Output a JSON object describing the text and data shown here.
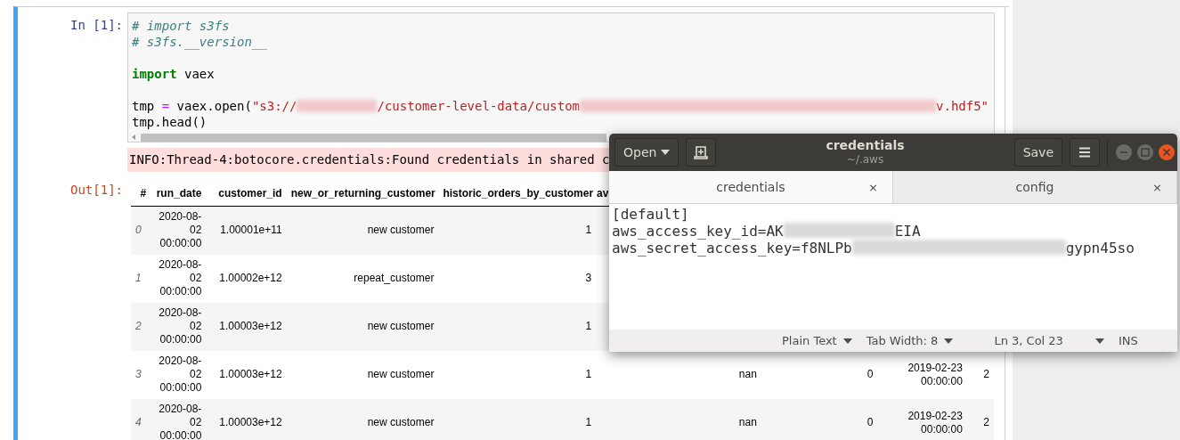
{
  "notebook": {
    "in_prompt": "In [1]:",
    "code_lines": [
      {
        "kind": "code",
        "tokens": [
          {
            "kind": "comment",
            "text": "# import s3fs"
          }
        ]
      },
      {
        "kind": "code",
        "tokens": [
          {
            "kind": "comment",
            "text": "# s3fs.__version__"
          }
        ]
      },
      {
        "kind": "blank"
      },
      {
        "kind": "code",
        "tokens": [
          {
            "kind": "keyword",
            "text": "import"
          },
          {
            "kind": "plain",
            "text": " vaex"
          }
        ]
      },
      {
        "kind": "blank"
      },
      {
        "kind": "code",
        "tokens": [
          {
            "kind": "plain",
            "text": "tmp "
          },
          {
            "kind": "operator",
            "text": "="
          },
          {
            "kind": "plain",
            "text": " vaex.open("
          },
          {
            "kind": "string",
            "text": "\"s3://"
          },
          {
            "kind": "redaction"
          },
          {
            "kind": "string",
            "text": "/customer-level-data/custom"
          },
          {
            "kind": "redaction"
          },
          {
            "kind": "string",
            "text": "v.hdf5\""
          }
        ]
      },
      {
        "kind": "code",
        "tokens": [
          {
            "kind": "plain",
            "text": "tmp.head()"
          }
        ]
      }
    ],
    "stderr": "INFO:Thread-4:botocore.credentials:Found credentials in shared c",
    "out_prompt": "Out[1]:",
    "table": {
      "columns": [
        "#",
        "run_date",
        "customer_id",
        "new_or_returning_customer",
        "historic_orders_by_customer",
        "av"
      ],
      "rows": [
        {
          "cells": [
            "0",
            "2020-08-02 00:00:00",
            "1.00001e+11",
            "new customer",
            "1"
          ]
        },
        {
          "cells": [
            "1",
            "2020-08-02 00:00:00",
            "1.00002e+12",
            "repeat_customer",
            "3"
          ]
        },
        {
          "cells": [
            "2",
            "2020-08-02 00:00:00",
            "1.00003e+12",
            "new customer",
            "1"
          ]
        },
        {
          "cells": [
            "3",
            "2020-08-02 00:00:00",
            "1.00003e+12",
            "new customer",
            "1",
            "nan",
            "0",
            "2019-02-23 00:00:00",
            "2"
          ]
        },
        {
          "cells": [
            "4",
            "2020-08-02 00:00:00",
            "1.00003e+12",
            "new customer",
            "1",
            "nan",
            "0",
            "2019-02-23 00:00:00",
            "2"
          ]
        }
      ]
    }
  },
  "editor": {
    "title": "credentials",
    "subtitle": "~/.aws",
    "open_label": "Open",
    "save_label": "Save",
    "tabs": [
      {
        "label": "credentials",
        "close": "×",
        "selected": true
      },
      {
        "label": "config",
        "close": "×",
        "selected": false
      }
    ],
    "lines": [
      [
        {
          "kind": "text",
          "text": "[default]"
        }
      ],
      [
        {
          "kind": "text",
          "text": "aws_access_key_id=AK"
        },
        {
          "kind": "redaction"
        },
        {
          "kind": "text",
          "text": "EIA"
        }
      ],
      [
        {
          "kind": "text",
          "text": "aws_secret_access_key=f8NLPb"
        },
        {
          "kind": "redaction"
        },
        {
          "kind": "text",
          "text": "gypn45so"
        }
      ]
    ],
    "status": {
      "language": "Plain Text",
      "tab_width": "Tab Width: 8",
      "position": "Ln 3, Col 23",
      "mode": "INS"
    }
  }
}
